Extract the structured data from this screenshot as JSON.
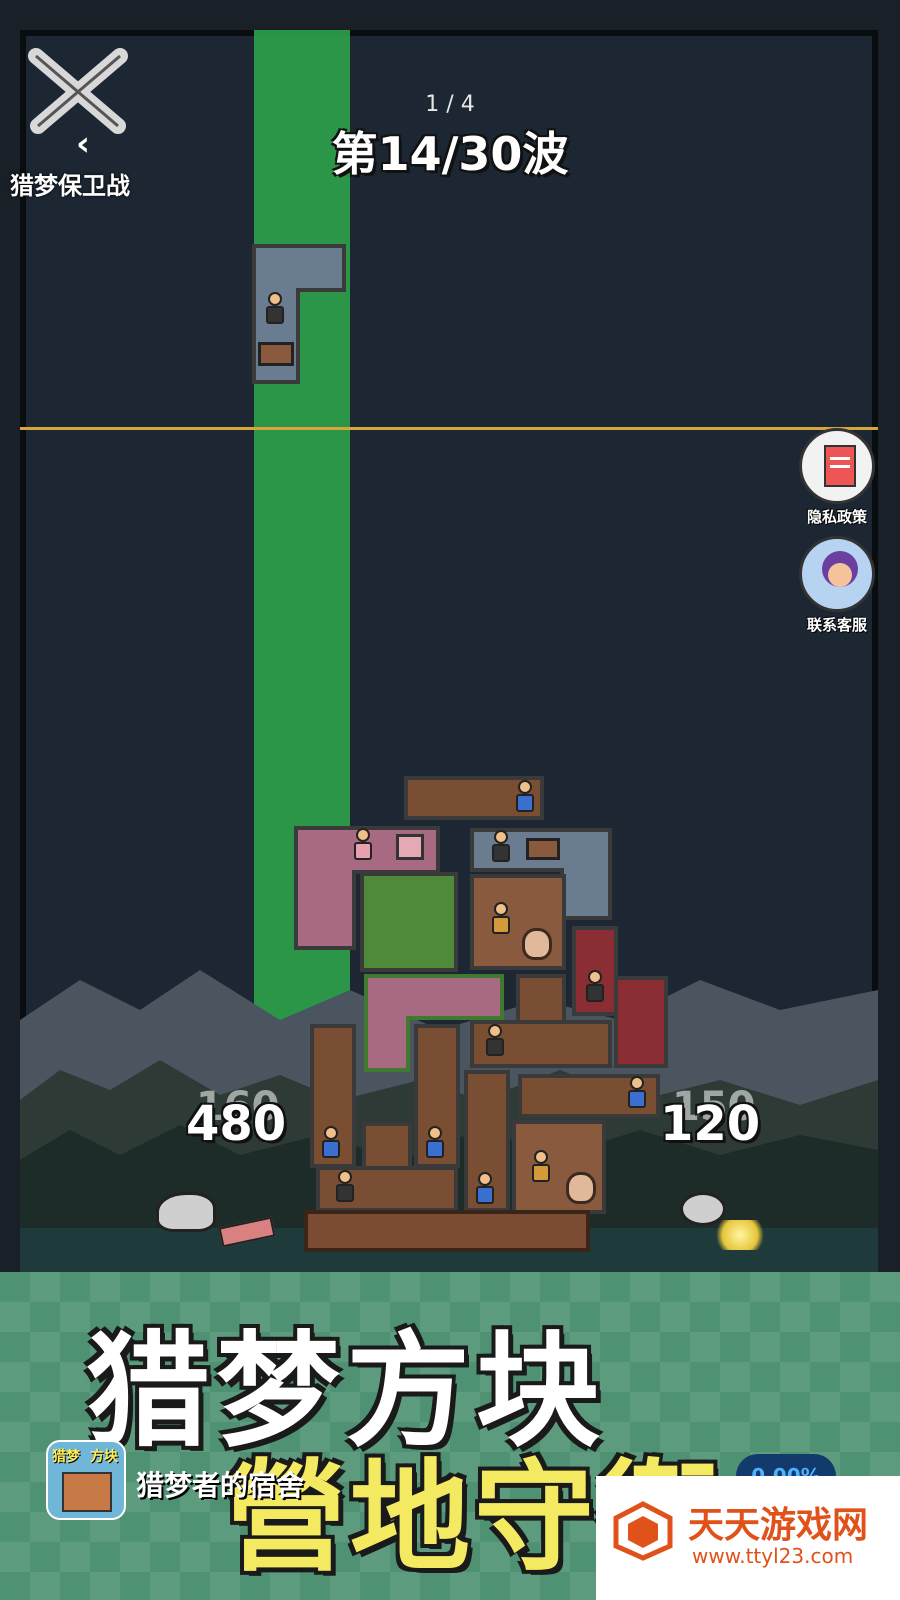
{
  "header": {
    "back_title": "猎梦保卫战",
    "page_indicator": "1 / 4",
    "wave_label": "第14/30波"
  },
  "side_buttons": [
    {
      "label": "隐私政策",
      "icon": "document-lock-icon"
    },
    {
      "label": "联系客服",
      "icon": "customer-service-icon"
    }
  ],
  "scores": {
    "left_value": "480",
    "left_ghost": "160",
    "right_value": "120",
    "right_ghost": "150"
  },
  "banner": {
    "title_line1": "猎梦方块",
    "title_line2": "營地守衛",
    "app_name": "猎梦者的宿舍",
    "app_icon_tag1": "猎梦",
    "app_icon_tag2": "方块",
    "progress_text": "0.00%"
  },
  "watermark": {
    "name": "天天游戏网",
    "url": "www.ttyl23.com"
  },
  "colors": {
    "sky": "#1c2733",
    "column": "#2ea04a",
    "danger_line": "#d8a53c",
    "banner": "#4f9273",
    "title_yellow": "#f3ea61",
    "watermark_orange": "#e0521a"
  }
}
